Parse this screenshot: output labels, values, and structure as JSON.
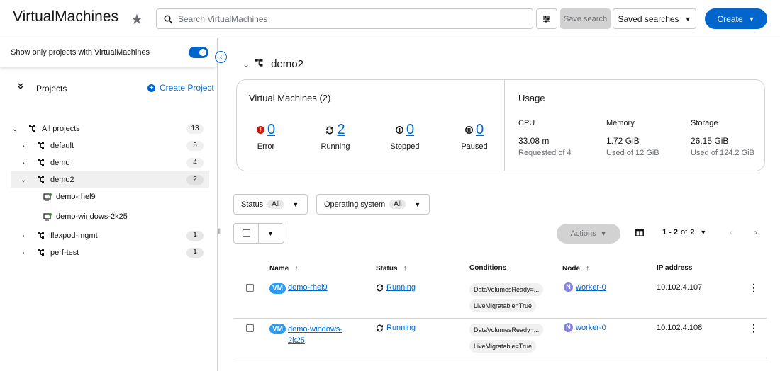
{
  "header": {
    "title": "VirtualMachines",
    "search_placeholder": "Search VirtualMachines",
    "save_search": "Save search",
    "saved_searches": "Saved searches",
    "create": "Create"
  },
  "sidebar": {
    "toggle_label": "Show only projects with VirtualMachines",
    "toggle_on": true,
    "projects_label": "Projects",
    "create_project": "Create Project",
    "tree": [
      {
        "label": "All projects",
        "count": "13",
        "expanded": true
      },
      {
        "label": "default",
        "count": "5"
      },
      {
        "label": "demo",
        "count": "4"
      },
      {
        "label": "demo2",
        "count": "2",
        "selected": true,
        "expanded": true
      },
      {
        "label": "demo-rhel9"
      },
      {
        "label": "demo-windows-2k25"
      },
      {
        "label": "flexpod-mgmt",
        "count": "1"
      },
      {
        "label": "perf-test",
        "count": "1"
      }
    ]
  },
  "main": {
    "project_title": "demo2",
    "vm_card": {
      "title": "Virtual Machines (2)",
      "statuses": [
        {
          "label": "Error",
          "count": "0",
          "icon": "error-icon"
        },
        {
          "label": "Running",
          "count": "2",
          "icon": "sync-icon"
        },
        {
          "label": "Stopped",
          "count": "0",
          "icon": "stop-icon"
        },
        {
          "label": "Paused",
          "count": "0",
          "icon": "pause-icon"
        }
      ]
    },
    "usage": {
      "title": "Usage",
      "cpu": {
        "label": "CPU",
        "value": "33.08 m",
        "sub": "Requested of 4"
      },
      "memory": {
        "label": "Memory",
        "value": "1.72 GiB",
        "sub": "Used of 12 GiB"
      },
      "storage": {
        "label": "Storage",
        "value": "26.15 GiB",
        "sub": "Used of 124.2 GiB"
      }
    },
    "filters": {
      "status_label": "Status",
      "status_value": "All",
      "os_label": "Operating system",
      "os_value": "All"
    },
    "toolbar": {
      "actions": "Actions",
      "pagination_range": "1 - 2",
      "pagination_of": "of",
      "pagination_total": "2"
    },
    "table": {
      "headers": {
        "name": "Name",
        "status": "Status",
        "conditions": "Conditions",
        "node": "Node",
        "ip": "IP address"
      },
      "vm_badge": "VM",
      "node_badge": "N",
      "rows": [
        {
          "name": "demo-rhel9",
          "status": "Running",
          "conditions": [
            "DataVolumesReady=...",
            "LiveMigratable=True"
          ],
          "node": "worker-0",
          "ip": "10.102.4.107"
        },
        {
          "name_line1": "demo-windows-",
          "name_line2": "2k25",
          "status": "Running",
          "conditions": [
            "DataVolumesReady=...",
            "LiveMigratable=True"
          ],
          "node": "worker-0",
          "ip": "10.102.4.108"
        }
      ]
    }
  },
  "colors": {
    "accent": "#0066cc",
    "error": "#c9190b",
    "vm_badge": "#2b9af3",
    "node_badge": "#8481dd"
  }
}
